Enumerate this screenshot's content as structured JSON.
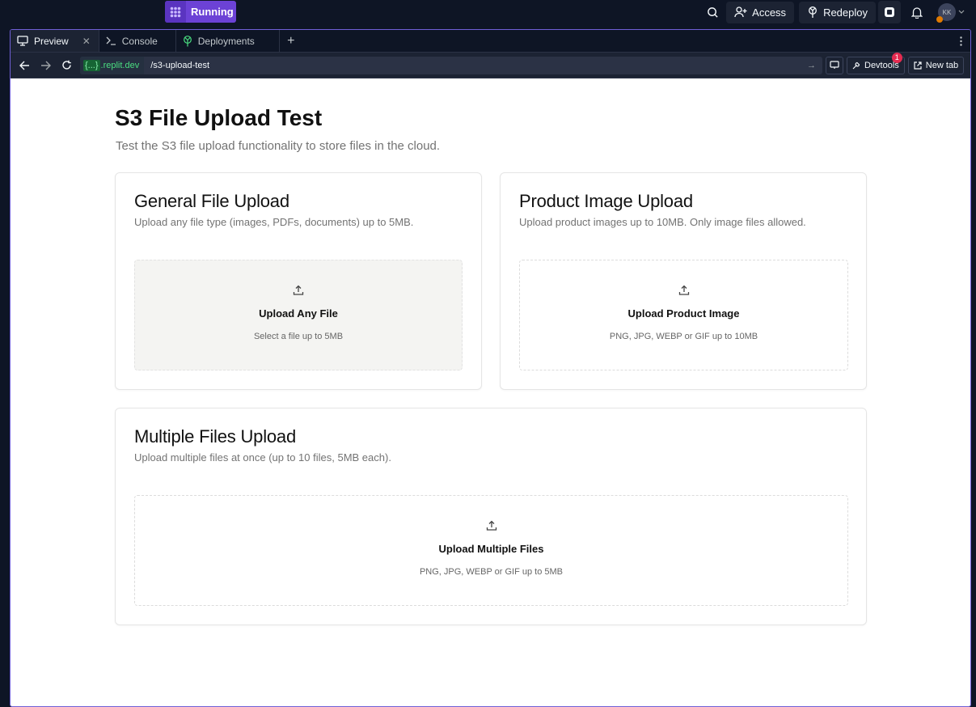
{
  "topbar": {
    "run_label": "Running",
    "access_label": "Access",
    "redeploy_label": "Redeploy",
    "avatar_initials": "KK"
  },
  "tabs": [
    {
      "label": "Preview",
      "icon": "monitor-icon",
      "active": true
    },
    {
      "label": "Console",
      "icon": "terminal-icon",
      "active": false
    },
    {
      "label": "Deployments",
      "icon": "deploy-icon",
      "active": false
    }
  ],
  "urlbar": {
    "domain_brace": "{...}",
    "domain_suffix": ".replit.dev",
    "path": "/s3-upload-test",
    "devtools_label": "Devtools",
    "devtools_badge": "1",
    "newtab_label": "New tab"
  },
  "page": {
    "title": "S3 File Upload Test",
    "subtitle": "Test the S3 file upload functionality to store files in the cloud.",
    "cards": {
      "general": {
        "title": "General File Upload",
        "desc": "Upload any file type (images, PDFs, documents) up to 5MB.",
        "drop_label": "Upload Any File",
        "drop_hint": "Select a file up to 5MB"
      },
      "product": {
        "title": "Product Image Upload",
        "desc": "Upload product images up to 10MB. Only image files allowed.",
        "drop_label": "Upload Product Image",
        "drop_hint": "PNG, JPG, WEBP or GIF up to 10MB"
      },
      "multiple": {
        "title": "Multiple Files Upload",
        "desc": "Upload multiple files at once (up to 10 files, 5MB each).",
        "drop_label": "Upload Multiple Files",
        "drop_hint": "PNG, JPG, WEBP or GIF up to 5MB"
      }
    }
  },
  "colors": {
    "accent": "#6c42d6",
    "pane_border": "#6f5fd6",
    "ide_bg": "#0e1525",
    "domain_green": "#4ade80"
  }
}
